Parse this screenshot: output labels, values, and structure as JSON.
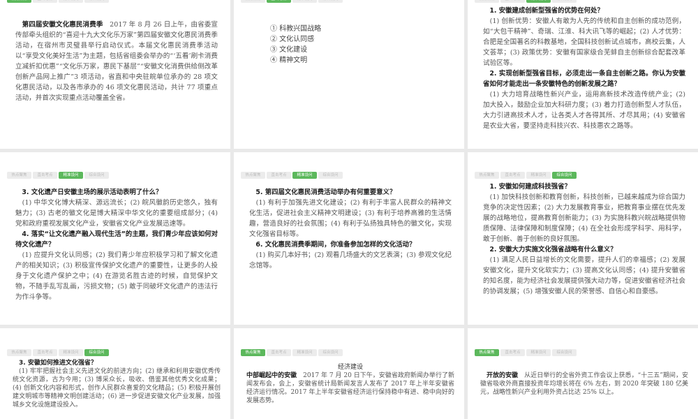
{
  "tabs": [
    "热点聚焦",
    "直击考点",
    "精准设问",
    "综合设问"
  ],
  "slides": [
    {
      "active": 0,
      "lead": "第四届安徽文化惠民消费季",
      "text": "2017 年 8 月 26 日上午，由省委宣传部牵头组织的“喜迎十九大文化乐万家”第四届安徽文化惠民消费季活动，在宿州市灵璧县举行启动仪式。本届文化惠民消费季活动以“享受文化美好生活”为主题，包括省组委会举办的“‘五看’刷卡消费立减折扣优惠”“文化乐万家，惠民下基层”“安徽文化消费供给侧改革创新产品网上推广”3 项活动，省直和中央驻皖单位承办的 28 项文化惠民活动，以及各市承办的 46 项文化惠民活动，共计 77 项重点活动，并首次实现重点活动覆盖全省。"
    },
    {
      "active": 1,
      "items": [
        "① 科教兴国战略",
        "② 文化认同感",
        "③ 文化建设",
        "④ 精神文明"
      ]
    },
    {
      "active": 2,
      "qa": [
        {
          "q": "1. 安徽建成创新型强省的优势在何处？",
          "a": "(1) 创新优势：安徽人有敢为人先的传统和自主创新的成功范例，如“大包干精神”、奇瑞、江淮、科大讯飞等的崛起；(2) 人才优势：合肥是全国著名的科教基地，全国科技创新试点城市，高校云集，人文荟萃；(3) 政策优势：安徽有国家级合芜蚌自主创新综合配套改革试验区等。"
        },
        {
          "q": "2. 实现创新型强省目标，必须走出一条自主创新之路。你认为安徽省如何才能走出一条安徽特色的创新发展之路？",
          "a": "(1) 大力培育战略性新兴产业，运用高新技术改造传统产业；(2) 加大投入，鼓励企业加大科研力度；(3) 着力打造创新型人才队伍，大力引进高技术人才，让各类人才各得其所、才尽其用；(4) 安徽省是农业大省，要坚持走科技兴农、科技惠农之路等。"
        }
      ]
    },
    {
      "active": 2,
      "qa": [
        {
          "q": "3. 文化遗产日安徽主场的展示活动表明了什么？",
          "a": "(1) 中华文化博大精深、源远流长；(2) 皖风徽韵历史悠久，独有魅力；(3) 古老的徽文化是博大精深中华文化的重要组成部分；(4) 党和政府重视发展文化产业，安徽省文化产业发展迅速等。"
        },
        {
          "q": "4. 落实“让文化遗产融入现代生活”的主题，我们青少年应该如何对待文化遗产？",
          "a": "(1) 应提升文化认同感；(2) 我们青少年应积极学习和了解文化遗产的相关知识；(3) 积极宣传保护文化遗产的重要性，让更多的人投身于文化遗产保护之中；(4) 在游览名胜古迹的时候，自觉保护文物，不随手乱写乱画，污损文物；(5) 敢于同破坏文化遗产的违法行为作斗争等。"
        }
      ]
    },
    {
      "active": 2,
      "qa": [
        {
          "q": "5. 第四届文化惠民消费活动举办有何重要意义？",
          "a": "(1) 有利于加强先进文化建设；(2) 有利于丰富人民群众的精神文化生活，促进社会主义精神文明建设；(3) 有利于培养高雅的生活情趣，营造良好的社会氛围；(4) 有利于弘扬独具特色的徽文化，实现文化强省目标等。"
        },
        {
          "q": "6. 文化惠民消费季期间，你准备参加怎样的文化活动？",
          "a": "(1) 购买几本好书；(2) 观看几场盛大的文艺表演；(3) 参观文化纪念馆等。"
        }
      ]
    },
    {
      "active": 3,
      "qa": [
        {
          "q": "1. 安徽如何建成科技强省？",
          "a": "(1) 加快科技创新和教育创新，科技创新，已越来越成为综合国力竞争的决定性因素；(2) 大力发展教育事业，把教育事业摆在优先发展的战略地位，提高教育创新能力；(3) 为实施科教兴皖战略提供物质保障、法律保障和制度保障；(4) 在全社会形成学科学、用科学，敢于创新、善于创新的良好氛围。"
        },
        {
          "q": "2. 安徽大力实施文化强省战略有什么意义？",
          "a": "(1) 满足人民日益增长的文化需要，提升人们的幸福感；(2) 发展安徽文化，提升文化软实力；(3) 提高文化认同感；(4) 提升安徽省的知名度，能为经济社会发展提供强大动力等，促进安徽省经济社会的协调发展；(5) 增强安徽人民的荣誉感、自信心和自豪感。"
        }
      ]
    },
    {
      "active": 3,
      "qa": [
        {
          "q": "3. 安徽如何推进文化强省？",
          "a": "(1) 牢牢把握社会主义先进文化的前进方向；(2) 继承和利用安徽优秀传统文化资源，古为今用；(3) 博采众长，吸收、借鉴其他优秀文化成果；(4) 创新文化内容和形式，创作人民群众喜爱的文化精品；(5) 积极开展创建文明城市等精神文明创建活动；(6) 进一步促进安徽文化产业发展，加强城乡文化设施建设投入。"
        }
      ]
    },
    {
      "active": 0,
      "heading": "经济建设",
      "lead": "中部崛起中的安徽",
      "text": "2017 年 7 月 20 日下午，安徽省政府新闻办举行了新闻发布会，会上，安徽省统计局新闻发言人发布了 2017 年上半年安徽省经济运行情况。2017 年上半年安徽省经济运行保持稳中有进、稳中向好的发展态势。"
    },
    {
      "active": 0,
      "lead": "开放的安徽",
      "text": "从近日举行的全省外资工作会议上获悉，“十三五”期间，安徽省吸收外商直接投资年均增长将在 6% 左右，到 2020 年突破 180 亿美元，战略性新兴产业利用外资占比达 25% 以上。"
    }
  ]
}
